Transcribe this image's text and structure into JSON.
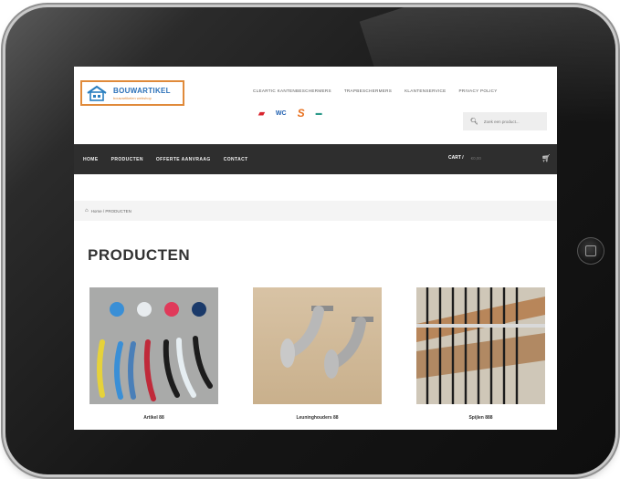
{
  "logo": {
    "name": "BOUWARTIKEL",
    "tagline": "bouwartikelen webshop"
  },
  "top_links": [
    "CLEARTIC KANTENBESCHERMERS",
    "TRAPBESCHERMERS",
    "KLANTENSERVICE",
    "PRIVACY POLICY"
  ],
  "brands": [
    {
      "label": "▰",
      "icon": "brand-1-logo"
    },
    {
      "label": "WC",
      "icon": "brand-2-logo"
    },
    {
      "label": "S",
      "icon": "brand-3-logo"
    },
    {
      "label": "▬",
      "icon": "brand-4-logo"
    }
  ],
  "search": {
    "placeholder": "Zoek een product..."
  },
  "nav": {
    "items": [
      "HOME",
      "PRODUCTEN",
      "OFFERTE AANVRAAG",
      "CONTACT"
    ]
  },
  "cart": {
    "label": "CART /",
    "amount": "€0,00"
  },
  "breadcrumb": {
    "home_icon": "home-icon",
    "text": "Home / PRODUCTEN"
  },
  "page": {
    "title": "PRODUCTEN"
  },
  "products": [
    {
      "name": "Artikel 88"
    },
    {
      "name": "Leuninghouders 88"
    },
    {
      "name": "Spijlen 888"
    }
  ],
  "colors": {
    "nav_bg": "#2e2e2e",
    "logo_border": "#e08a3a",
    "logo_text": "#2a70b8"
  }
}
